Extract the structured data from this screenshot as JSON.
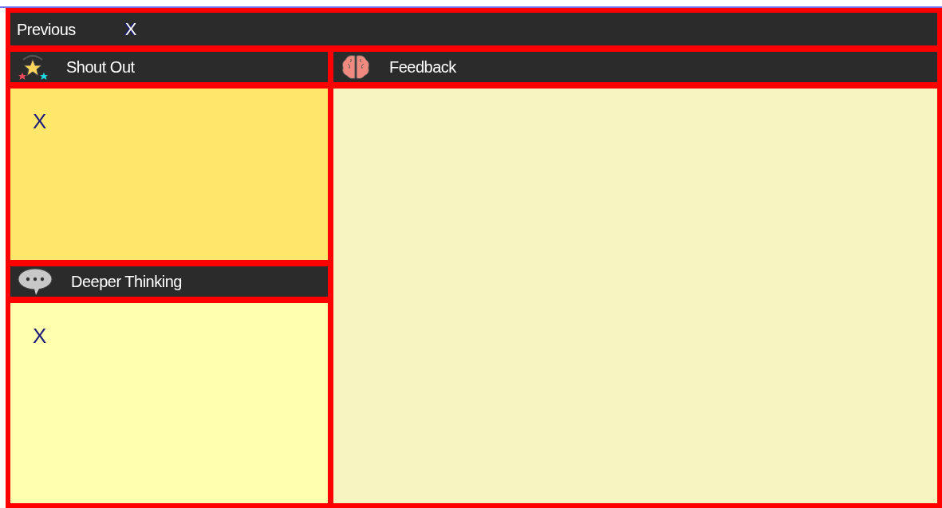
{
  "top_bar": {
    "button": "Previous",
    "mark": "X"
  },
  "panels": [
    {
      "kind": "star",
      "title": "Shout Out",
      "body": "X"
    },
    {
      "kind": "speech",
      "title": "Deeper Thinking",
      "body": "X"
    },
    {
      "kind": "brain",
      "title": "Feedback"
    }
  ]
}
